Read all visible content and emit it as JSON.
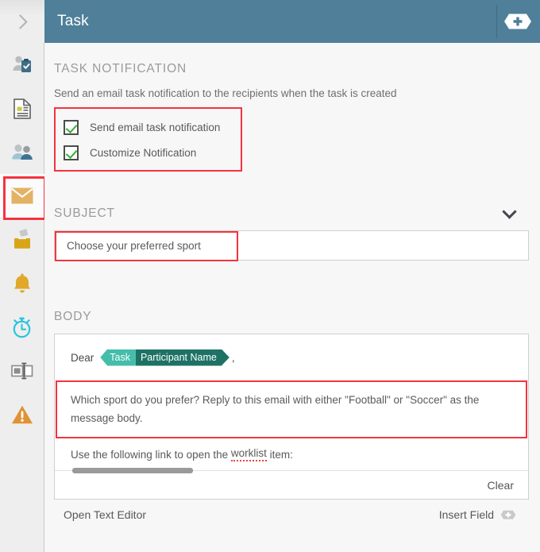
{
  "sidebar": {
    "collapse_icon": "chevron-right-icon",
    "items": [
      {
        "icon": "person-clipboard-icon",
        "name": "task-details",
        "active": false
      },
      {
        "icon": "document-icon",
        "name": "form",
        "active": false
      },
      {
        "icon": "people-icon",
        "name": "participants",
        "active": false
      },
      {
        "icon": "envelope-icon",
        "name": "notification",
        "active": true
      },
      {
        "icon": "inbox-icon",
        "name": "inbox",
        "active": false
      },
      {
        "icon": "bell-icon",
        "name": "reminders",
        "active": false
      },
      {
        "icon": "stopwatch-icon",
        "name": "deadline",
        "active": false
      },
      {
        "icon": "input-field-icon",
        "name": "data-fields",
        "active": false
      },
      {
        "icon": "warning-triangle-icon",
        "name": "escalation",
        "active": false
      }
    ]
  },
  "header": {
    "title": "Task",
    "add_icon": "add-hex-icon"
  },
  "notification": {
    "section_title": "TASK NOTIFICATION",
    "description": "Send an email task notification to the recipients when the task is created",
    "checkboxes": [
      {
        "label": "Send email task notification",
        "checked": true
      },
      {
        "label": "Customize Notification",
        "checked": true
      }
    ]
  },
  "subject": {
    "section_title": "SUBJECT",
    "collapse_icon": "chevron-down-icon",
    "value": "Choose your preferred sport"
  },
  "body": {
    "section_title": "BODY",
    "greeting_prefix": "Dear",
    "chip": {
      "category": "Task",
      "field": "Participant Name"
    },
    "greeting_suffix": ",",
    "message": "Which sport do you prefer? Reply to this email with either \"Football\" or \"Soccer\" as the message body.",
    "link_line_prefix": "Use the following link to open the",
    "link_line_word": "worklist",
    "link_line_suffix": "item:",
    "clear_label": "Clear"
  },
  "footer": {
    "open_text_editor": "Open Text Editor",
    "insert_field": "Insert Field",
    "insert_field_icon": "add-hex-icon"
  },
  "colors": {
    "header_bg": "#4f7f99",
    "highlight": "#f5333f",
    "chip_category": "#45bdab",
    "chip_field": "#1e7265",
    "check": "#35b132",
    "sidebar_bg": "#eeeeee",
    "content_bg": "#f7f7f7"
  }
}
